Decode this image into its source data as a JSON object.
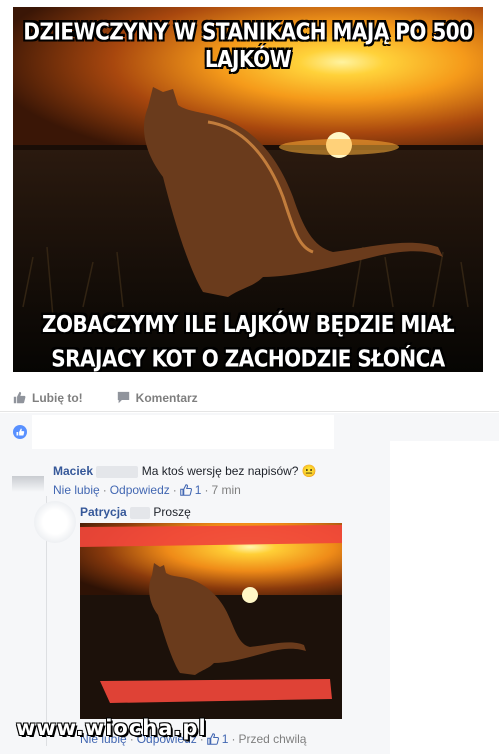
{
  "meme": {
    "top_caption": "DZIEWCZYNY W STANIKACH MAJĄ PO 500 LAJKÓW",
    "bottom_caption_line1": "ZOBACZYMY ILE LAJKÓW BĘDZIE MIAŁ",
    "bottom_caption_line2": "SRAJACY KOT O ZACHODZIE SŁOŃCA"
  },
  "actions": {
    "like_label": "Lubię to!",
    "like_icon": "thumbs-up-icon",
    "comment_label": "Komentarz",
    "comment_icon": "comment-icon"
  },
  "comments": [
    {
      "author": "Maciek",
      "text": "Ma ktoś wersję bez napisów?",
      "emoji": "😐",
      "unlike": "Nie lubię",
      "reply": "Odpowiedz",
      "likes": "1",
      "time": "7 min"
    }
  ],
  "reply": {
    "author": "Patrycja",
    "text": "Proszę",
    "unlike": "Nie lubię",
    "reply": "Odpowiedz",
    "likes": "1",
    "time": "Przed chwilą"
  },
  "watermark": "www.wiocha.pl",
  "colors": {
    "link": "#4267b2",
    "name": "#365899",
    "meta": "#7f7f7f",
    "sun": "#ffd23a",
    "redaction": "#f0463b"
  }
}
